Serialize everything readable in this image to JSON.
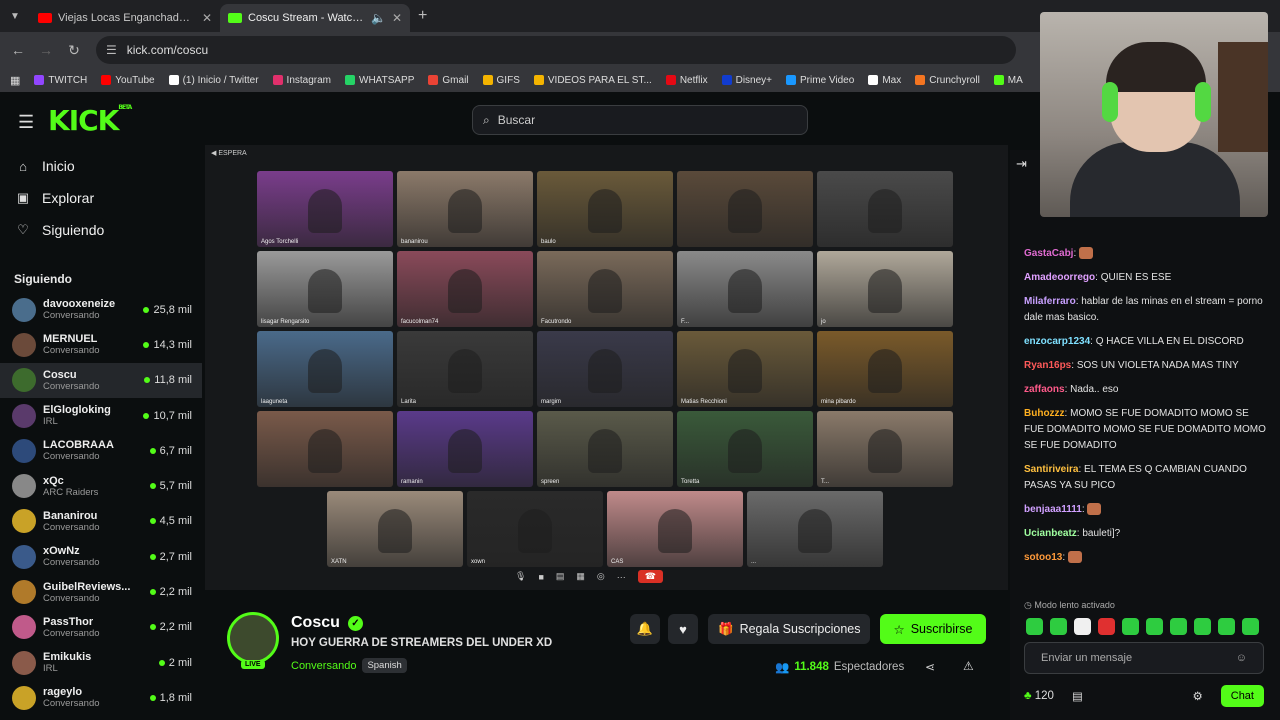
{
  "browser": {
    "tabs": [
      {
        "title": "Viejas Locas Enganchados Parte",
        "color": "#ff0000",
        "active": false
      },
      {
        "title": "Coscu Stream - Watch Live",
        "color": "#53fc18",
        "active": true
      }
    ],
    "url": "kick.com/coscu",
    "bookmarks": [
      {
        "label": "TWITCH",
        "color": "#9146ff"
      },
      {
        "label": "YouTube",
        "color": "#ff0000"
      },
      {
        "label": "(1) Inicio / Twitter",
        "color": "#ffffff"
      },
      {
        "label": "Instagram",
        "color": "#e1306c"
      },
      {
        "label": "WHATSAPP",
        "color": "#25d366"
      },
      {
        "label": "Gmail",
        "color": "#ea4335"
      },
      {
        "label": "GIFS",
        "color": "#f4b400"
      },
      {
        "label": "VIDEOS PARA EL ST...",
        "color": "#f4b400"
      },
      {
        "label": "Netflix",
        "color": "#e50914"
      },
      {
        "label": "Disney+",
        "color": "#113ccf"
      },
      {
        "label": "Prime Video",
        "color": "#1a98ff"
      },
      {
        "label": "Max",
        "color": "#ffffff"
      },
      {
        "label": "Crunchyroll",
        "color": "#f47521"
      },
      {
        "label": "MA",
        "color": "#53fc18"
      }
    ]
  },
  "header": {
    "logo": "KICK",
    "logo_beta": "BETA",
    "search_placeholder": "Buscar"
  },
  "sidebar": {
    "nav": [
      {
        "label": "Inicio",
        "icon": "home-icon"
      },
      {
        "label": "Explorar",
        "icon": "compass-icon"
      },
      {
        "label": "Siguiendo",
        "icon": "heart-icon"
      }
    ],
    "following_title": "Siguiendo",
    "channels": [
      {
        "name": "davooxeneize",
        "category": "Conversando",
        "viewers": "25,8 mil",
        "color": "#4a6d8c"
      },
      {
        "name": "MERNUEL",
        "category": "Conversando",
        "viewers": "14,3 mil",
        "color": "#6b4a3a"
      },
      {
        "name": "Coscu",
        "category": "Conversando",
        "viewers": "11,8 mil",
        "color": "#3d6b2d",
        "active": true
      },
      {
        "name": "ElGlogloking",
        "category": "IRL",
        "viewers": "10,7 mil",
        "color": "#5a3a6b"
      },
      {
        "name": "LACOBRAAA",
        "category": "Conversando",
        "viewers": "6,7 mil",
        "color": "#2d4a7a"
      },
      {
        "name": "xQc",
        "category": "ARC Raiders",
        "viewers": "5,7 mil",
        "color": "#888888"
      },
      {
        "name": "Bananirou",
        "category": "Conversando",
        "viewers": "4,5 mil",
        "color": "#c9a227"
      },
      {
        "name": "xOwNz",
        "category": "Conversando",
        "viewers": "2,7 mil",
        "color": "#3a5a8a"
      },
      {
        "name": "GuibelReviews...",
        "category": "Conversando",
        "viewers": "2,2 mil",
        "color": "#b07a2a"
      },
      {
        "name": "PassThor",
        "category": "Conversando",
        "viewers": "2,2 mil",
        "color": "#c05a8a"
      },
      {
        "name": "Emikukis",
        "category": "IRL",
        "viewers": "2 mil",
        "color": "#8a5a4a"
      },
      {
        "name": "rageylo",
        "category": "Conversando",
        "viewers": "1,8 mil",
        "color": "#c9a227"
      }
    ]
  },
  "video": {
    "top_label": "ESPERA",
    "tiles": [
      {
        "label": "Agos Torchelli",
        "bg": "#7a3d8c"
      },
      {
        "label": "bananirou",
        "bg": "#8c7a6a"
      },
      {
        "label": "baulo",
        "bg": "#6a5a3a"
      },
      {
        "label": "",
        "bg": "#5a4a3a"
      },
      {
        "label": "",
        "bg": "#4a4a4a"
      },
      {
        "label": "lisagar Rengarsito",
        "bg": "#9a9a9a"
      },
      {
        "label": "facucolman74",
        "bg": "#8a4a5a"
      },
      {
        "label": "Facutrondo",
        "bg": "#7a6a5a"
      },
      {
        "label": "F...",
        "bg": "#8a8a8a"
      },
      {
        "label": "jo",
        "bg": "#b0a89a"
      },
      {
        "label": "laaguneta",
        "bg": "#4a6a8a"
      },
      {
        "label": "Larita",
        "bg": "#3a3a3a"
      },
      {
        "label": "margim",
        "bg": "#3a3a4a"
      },
      {
        "label": "Matias Recchioni",
        "bg": "#6a5a3a"
      },
      {
        "label": "mina pibardo",
        "bg": "#7a5a2a"
      },
      {
        "label": "",
        "bg": "#7a5a4a"
      },
      {
        "label": "ramanin",
        "bg": "#5a3a8a"
      },
      {
        "label": "spreen",
        "bg": "#5a5a4a"
      },
      {
        "label": "Toretta",
        "bg": "#3a5a3a"
      },
      {
        "label": "T...",
        "bg": "#8a7a6a"
      },
      {
        "label": "XATN",
        "bg": "#9a8a7a"
      },
      {
        "label": "xown",
        "bg": "#2a2a2a"
      },
      {
        "label": "CAS",
        "bg": "#c08a8a"
      },
      {
        "label": "...",
        "bg": "#6a6a6a"
      }
    ]
  },
  "stream": {
    "streamer": "Coscu",
    "live_badge": "LIVE",
    "title": "HOY GUERRA DE STREAMERS DEL UNDER XD",
    "category": "Conversando",
    "language": "Spanish",
    "gift_label": "Regala Suscripciones",
    "subscribe_label": "Suscribirse",
    "viewer_count": "11.848",
    "viewer_label": "Espectadores"
  },
  "chat": {
    "messages": [
      {
        "user": "GastaCabj",
        "color": "#e06bd1",
        "text": ""
      },
      {
        "user": "Amadeoorrego",
        "color": "#e0a0ff",
        "text": "QUIEN ES ESE"
      },
      {
        "user": "Milaferraro",
        "color": "#c8a0ff",
        "text": "hablar de las minas en el stream = porno dale mas basico."
      },
      {
        "user": "enzocarp1234",
        "color": "#7fe0ff",
        "text": "Q HACE VILLA EN EL DISCORD"
      },
      {
        "user": "Ryan16ps",
        "color": "#ff5a5a",
        "text": "SOS UN VIOLETA NADA MAS TINY"
      },
      {
        "user": "zaffaons",
        "color": "#ff5a8a",
        "text": "Nada.. eso"
      },
      {
        "user": "Buhozzz",
        "color": "#ffb020",
        "text": "MOMO SE FUE DOMADITO MOMO SE FUE DOMADITO MOMO SE FUE DOMADITO MOMO SE FUE DOMADITO"
      },
      {
        "user": "Santiriveira",
        "color": "#ffc040",
        "text": "EL TEMA ES Q CAMBIAN CUANDO PASAS YA SU PICO"
      },
      {
        "user": "benjaaa1111",
        "color": "#d0a0ff",
        "text": ""
      },
      {
        "user": "Ucianbeatz",
        "color": "#a0ffa0",
        "text": "bauleti]?"
      },
      {
        "user": "sotoo13",
        "color": "#ff9a3a",
        "text": ""
      }
    ],
    "slow_mode": "Modo lento activado",
    "input_placeholder": "Enviar un mensaje",
    "points": "120",
    "chat_button": "Chat"
  }
}
